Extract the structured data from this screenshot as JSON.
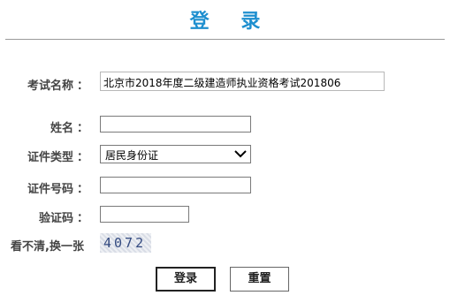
{
  "header": {
    "title": "登 录"
  },
  "form": {
    "exam_name": {
      "label": "考试名称",
      "value": "北京市2018年度二级建造师执业资格考试201806"
    },
    "name": {
      "label": "姓名",
      "value": ""
    },
    "id_type": {
      "label": "证件类型",
      "selected": "居民身份证"
    },
    "id_number": {
      "label": "证件号码",
      "value": ""
    },
    "captcha": {
      "label": "验证码",
      "value": ""
    },
    "refresh_link": "看不清,换一张",
    "captcha_text": "4072",
    "colon": "："
  },
  "buttons": {
    "login": "登录",
    "reset": "重置"
  }
}
